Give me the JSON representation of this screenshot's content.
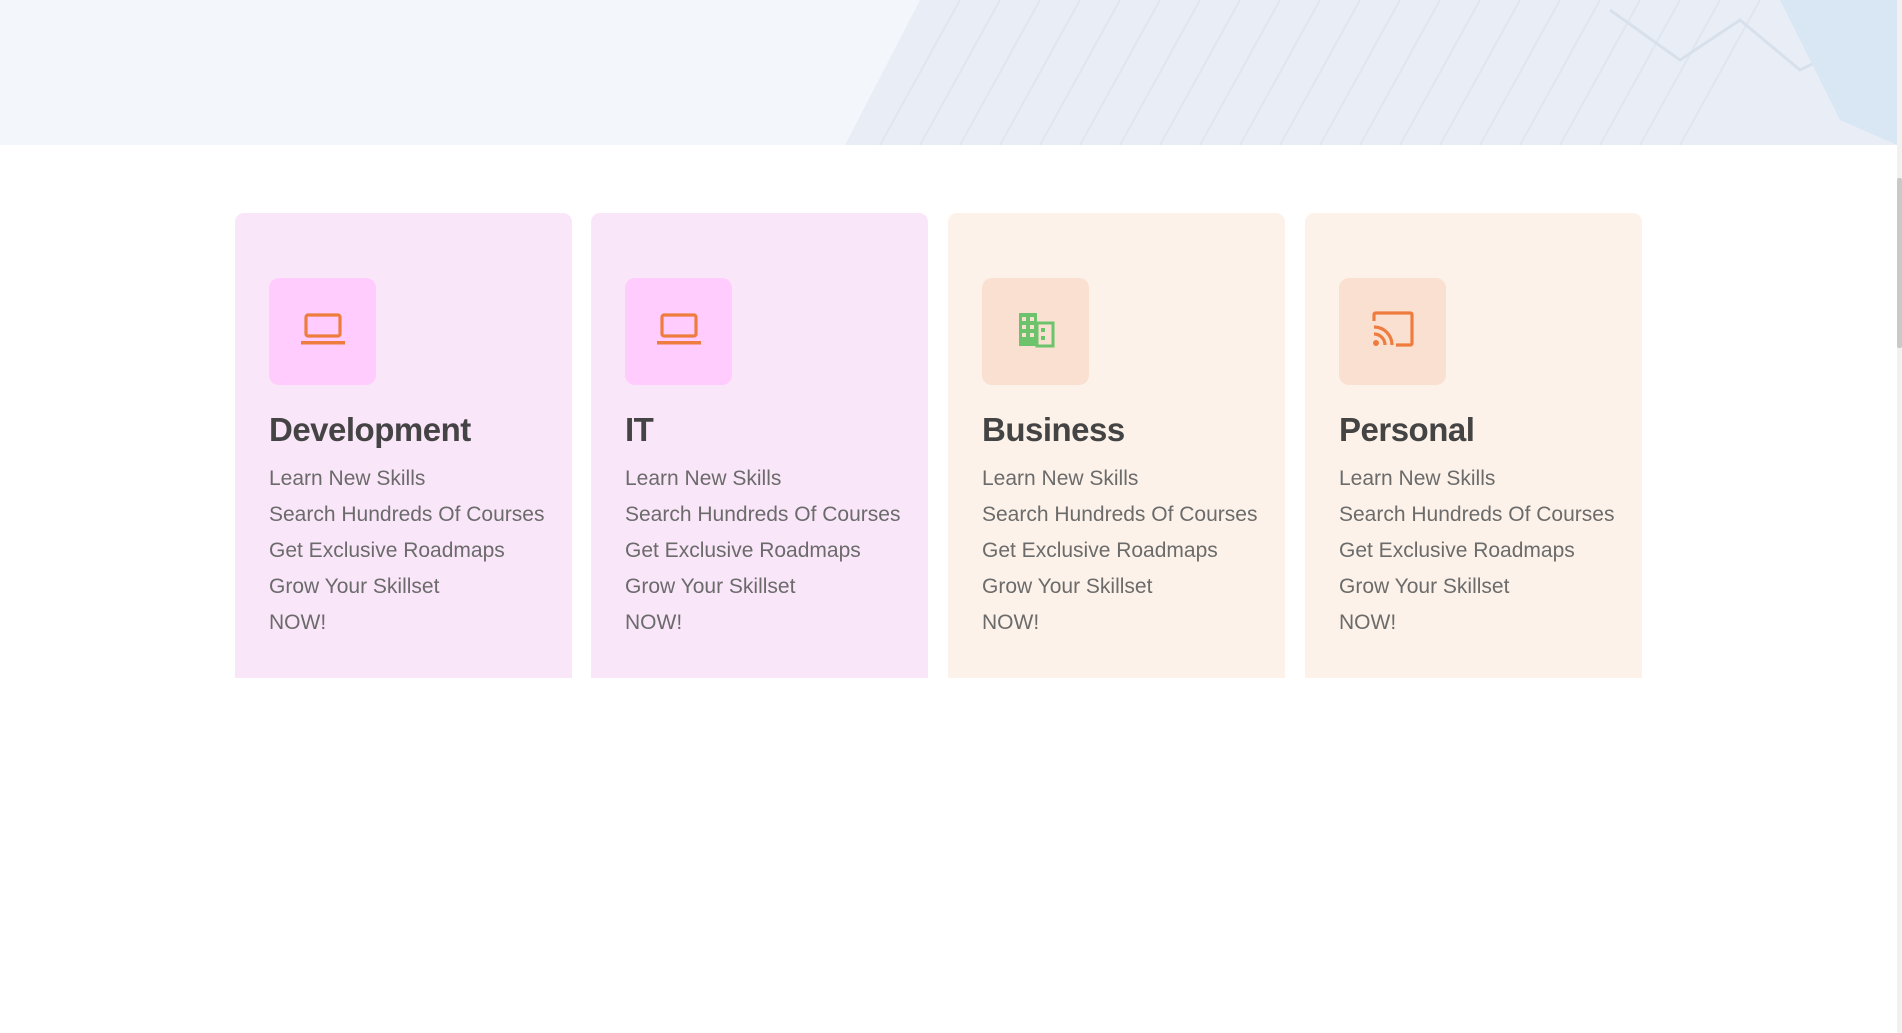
{
  "hero": {},
  "cards": [
    {
      "title": "Development",
      "icon": "laptop-icon",
      "icon_color": "#ee7c3e",
      "background": "#fae6f9",
      "items": [
        "Learn New Skills",
        "Search Hundreds Of Courses",
        "Get Exclusive Roadmaps",
        "Grow Your Skillset",
        "NOW!"
      ]
    },
    {
      "title": "IT",
      "icon": "laptop-icon",
      "icon_color": "#ee7c3e",
      "background": "#fae6f9",
      "items": [
        "Learn New Skills",
        "Search Hundreds Of Courses",
        "Get Exclusive Roadmaps",
        "Grow Your Skillset",
        "NOW!"
      ]
    },
    {
      "title": "Business",
      "icon": "building-icon",
      "icon_color": "#6cc36c",
      "background": "#fcf2e9",
      "items": [
        "Learn New Skills",
        "Search Hundreds Of Courses",
        "Get Exclusive Roadmaps",
        "Grow Your Skillset",
        "NOW!"
      ]
    },
    {
      "title": "Personal",
      "icon": "cast-icon",
      "icon_color": "#ee7c3e",
      "background": "#fcf2e9",
      "items": [
        "Learn New Skills",
        "Search Hundreds Of Courses",
        "Get Exclusive Roadmaps",
        "Grow Your Skillset",
        "NOW!"
      ]
    }
  ]
}
